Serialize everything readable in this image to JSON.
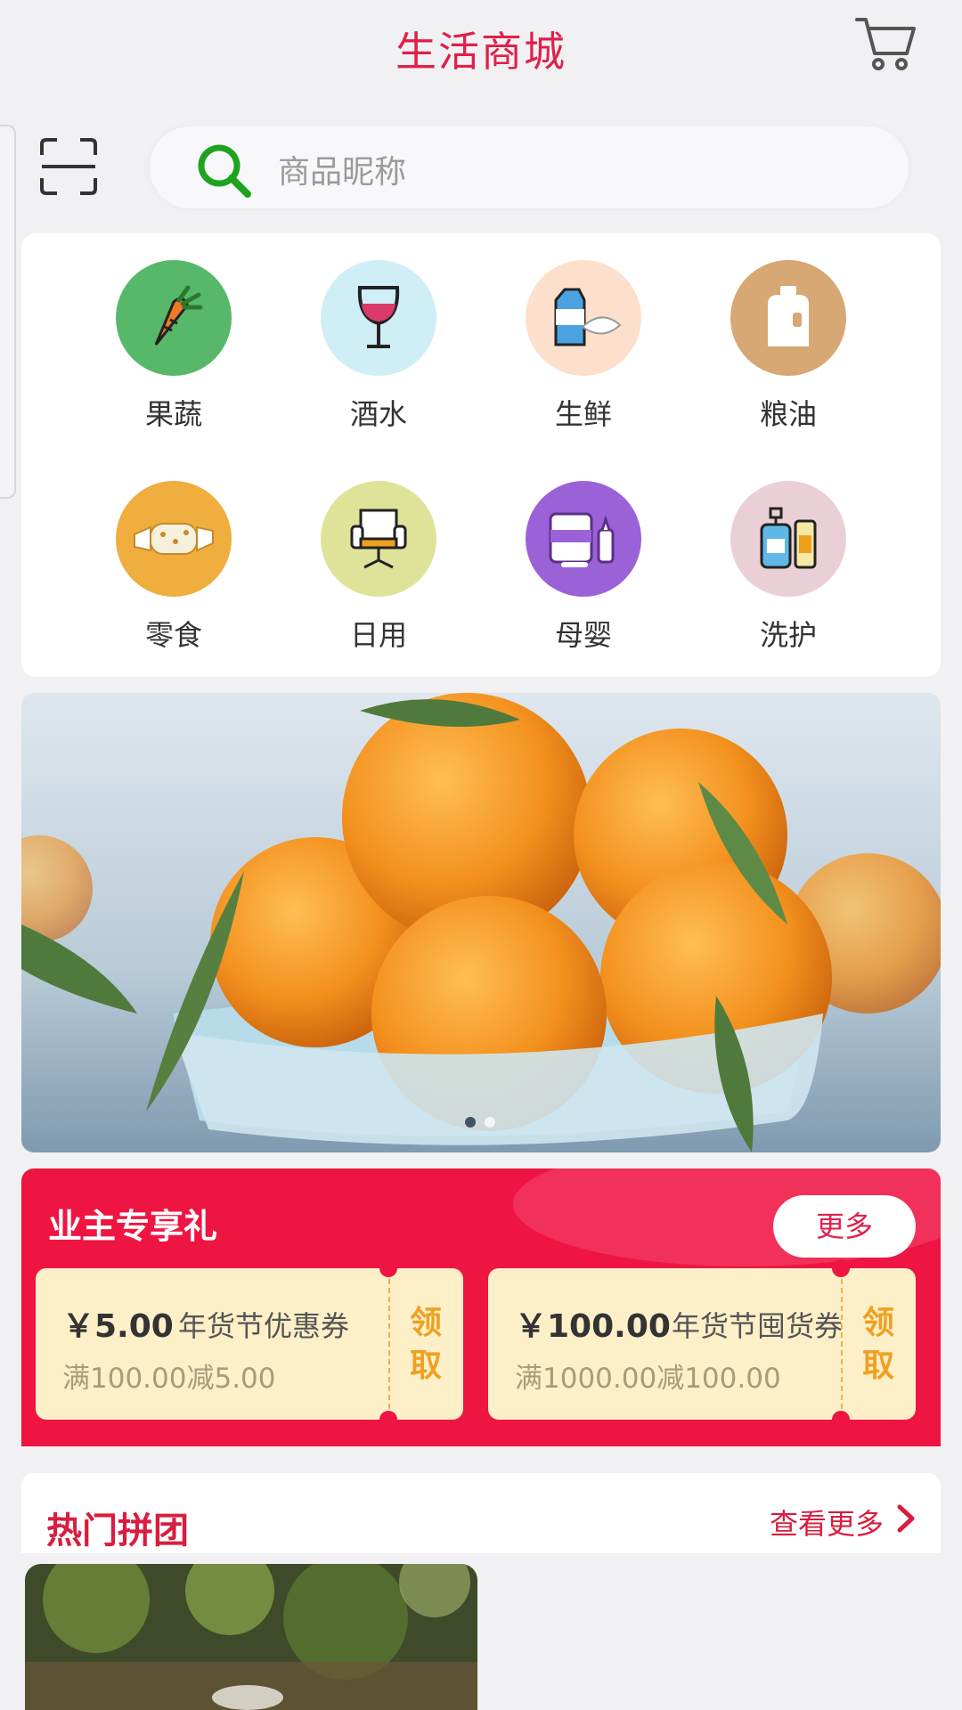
{
  "header": {
    "title": "生活商城",
    "cart_icon": "shopping-cart-icon"
  },
  "search": {
    "placeholder": "商品昵称",
    "scan_icon": "scan-icon",
    "search_icon": "search-icon"
  },
  "categories": [
    {
      "label": "果蔬",
      "icon": "carrot-icon",
      "color": "#57b86a"
    },
    {
      "label": "酒水",
      "icon": "wine-glass-icon",
      "color": "#cfeef6"
    },
    {
      "label": "生鲜",
      "icon": "milk-fish-icon",
      "color": "#fde0cc"
    },
    {
      "label": "粮油",
      "icon": "oil-bottle-icon",
      "color": "#d7a774"
    },
    {
      "label": "零食",
      "icon": "candy-icon",
      "color": "#efae3d"
    },
    {
      "label": "日用",
      "icon": "chair-icon",
      "color": "#dfe39a"
    },
    {
      "label": "母婴",
      "icon": "milk-powder-icon",
      "color": "#9b62d8"
    },
    {
      "label": "洗护",
      "icon": "lotion-bottle-icon",
      "color": "#ead0d6"
    }
  ],
  "banner": {
    "slides": 2,
    "active_slide": 1
  },
  "gift": {
    "title": "业主专享礼",
    "more_label": "更多",
    "coupons": [
      {
        "amount": "￥5.00",
        "name": "年货节优惠券",
        "condition": "满100.00减5.00",
        "claim": "领取"
      },
      {
        "amount": "￥100.00",
        "name": "年货节囤货券",
        "condition": "满1000.00减100.00",
        "claim": "领取"
      }
    ]
  },
  "hot_group": {
    "title": "热门拼团",
    "more_label": "查看更多"
  },
  "colors": {
    "brand": "#e0204a",
    "gift_bg": "#ef1542",
    "coupon_bg": "#fdf0c9",
    "claim": "#f0a020"
  }
}
